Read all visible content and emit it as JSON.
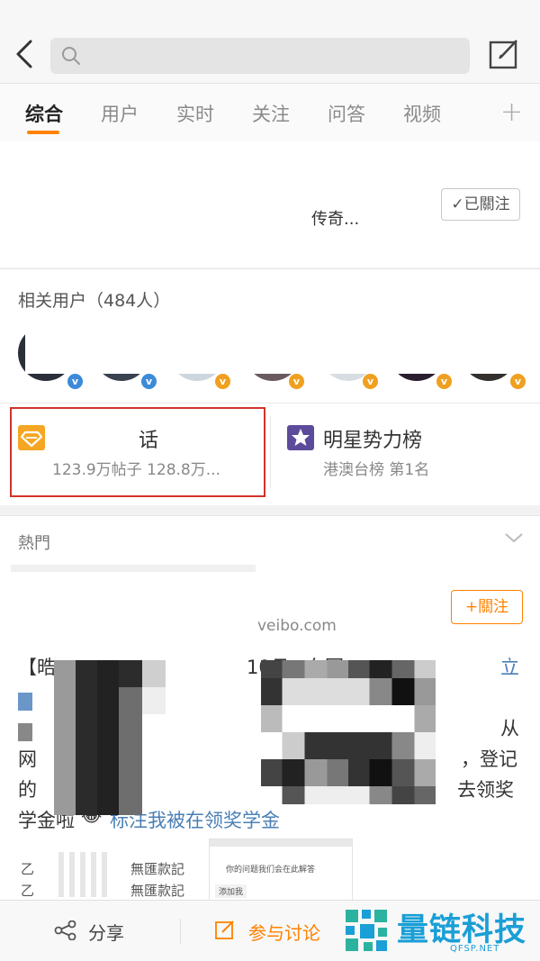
{
  "header": {
    "search_placeholder": ""
  },
  "tabs": [
    {
      "label": "综合",
      "active": true
    },
    {
      "label": "用户"
    },
    {
      "label": "实时"
    },
    {
      "label": "关注"
    },
    {
      "label": "问答"
    },
    {
      "label": "视频"
    }
  ],
  "tab_add": "+",
  "top_card": {
    "text": "传奇...",
    "follow_label": "✓已關注"
  },
  "related_users": {
    "title": "相关用户（484人）",
    "badge_colors": [
      "#3c8bd8",
      "#3c8bd8",
      "#f0a020",
      "#f0a020",
      "#f0a020",
      "#f0a020",
      "#f0a020"
    ]
  },
  "topic": {
    "name": "话",
    "stats": "123.9万帖子  128.8万...",
    "accent": "#f5a623",
    "highlight": "#d0342c"
  },
  "star_rank": {
    "name": "明星势力榜",
    "sub": "港澳台榜 第1名"
  },
  "hot": {
    "title": "熱門"
  },
  "post": {
    "follow_label": "+關注",
    "source": "veibo.com",
    "line1_left": "【晧",
    "line1_mid": "10月",
    "line1_mid2": "东园",
    "line1_right": "立",
    "line3_right": "从",
    "line4_left": "网",
    "line4_right": "，登记",
    "line5_left": "的",
    "line5_right": "去领奖",
    "line6_left": "学金啦",
    "line6_link": "标注我被在领奖学金",
    "thumb_rows": [
      "乙",
      "乙"
    ],
    "thumb_mid": [
      "無匯款記",
      "無匯款記"
    ],
    "thumb_chat": "添加我",
    "thumb_chat_top": "你的问题我们会在此解答"
  },
  "bottom": {
    "share": "分享",
    "discuss": "参与讨论"
  },
  "watermark": {
    "text": "量链科技",
    "sub": "QFSP.NET"
  }
}
